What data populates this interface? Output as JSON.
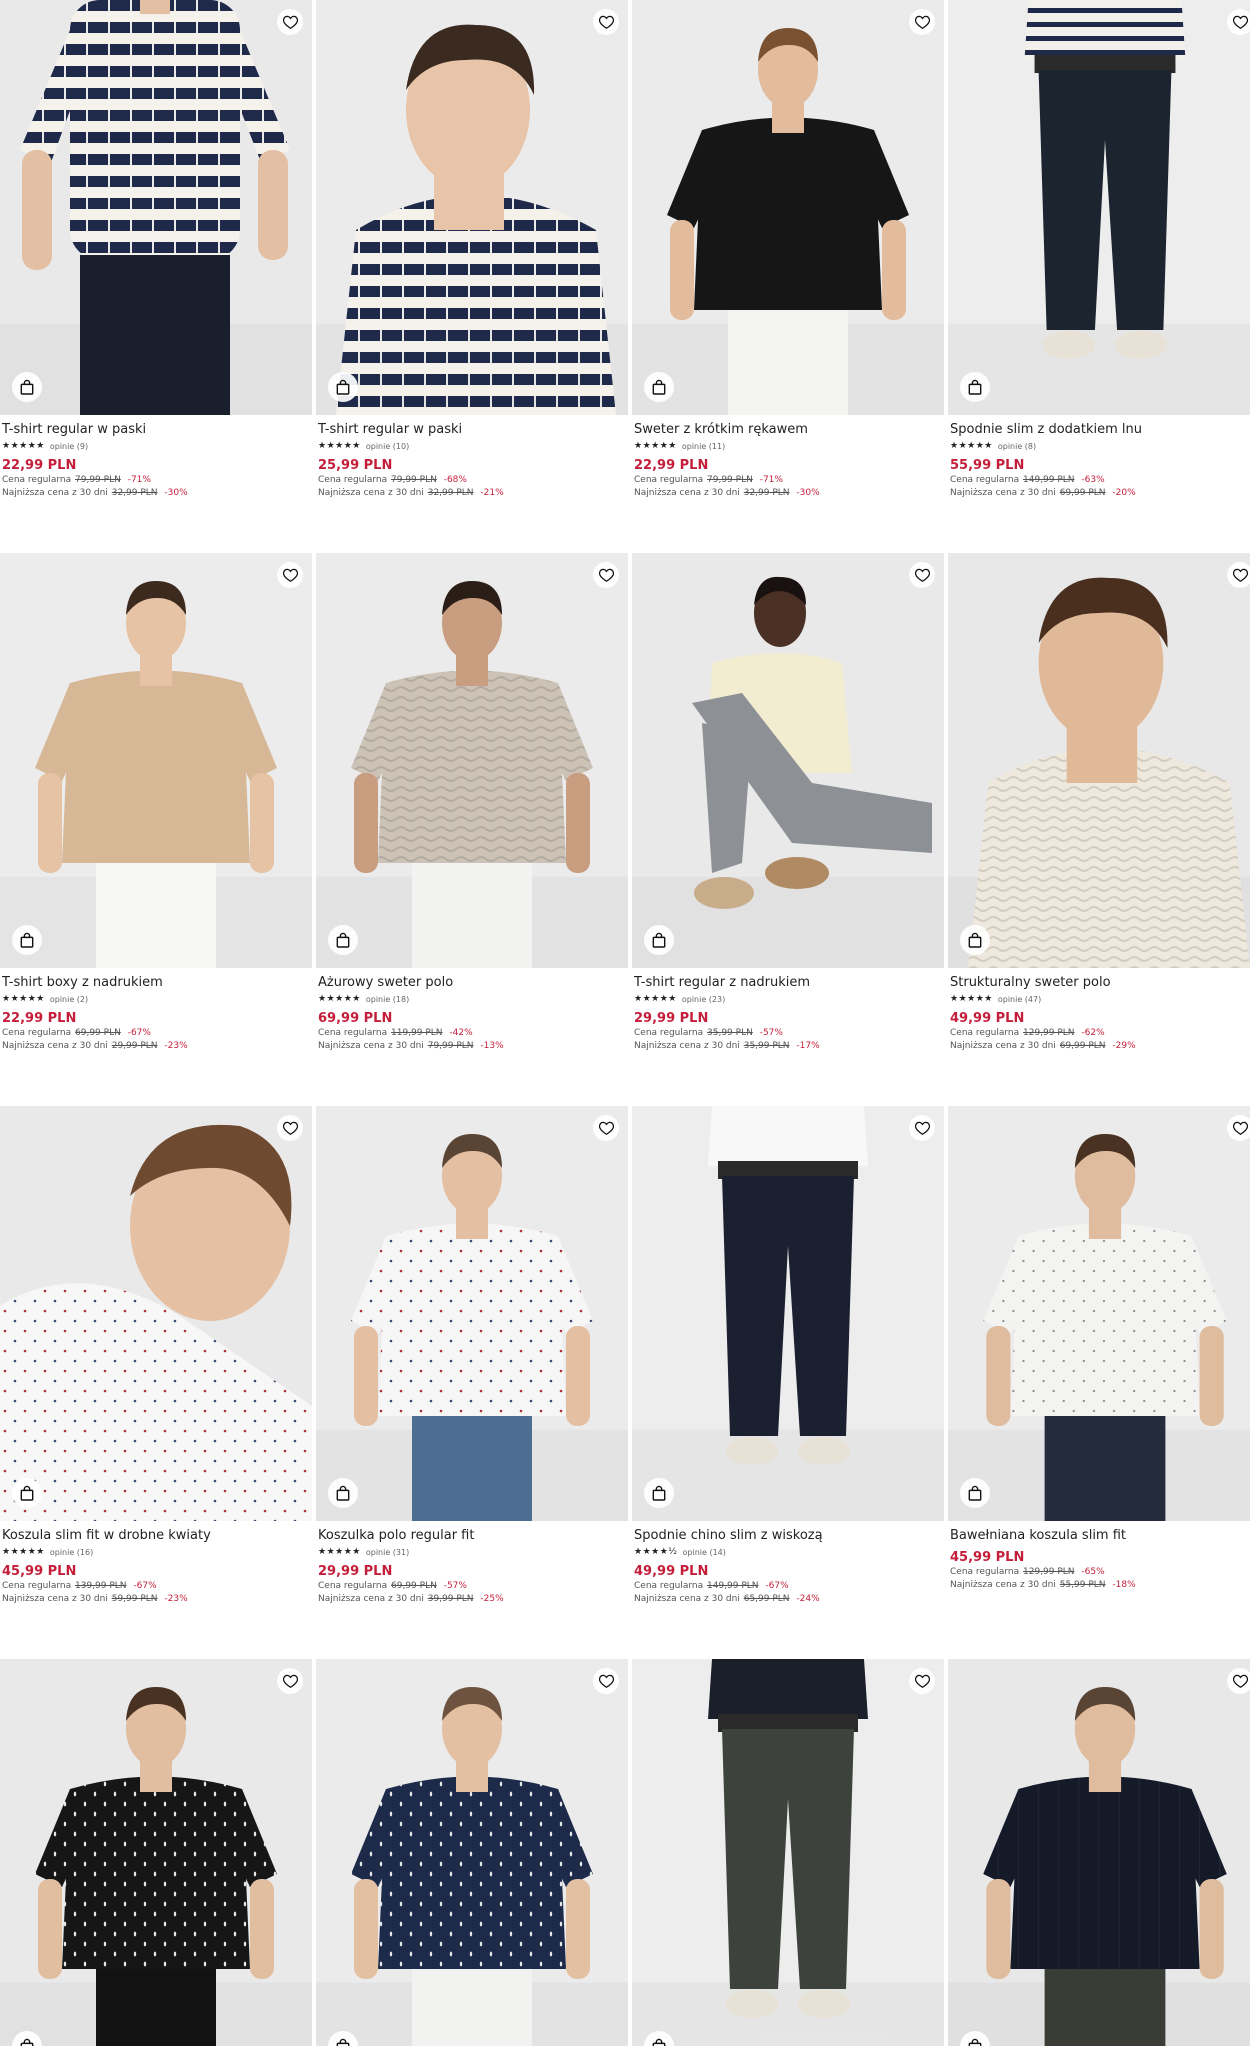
{
  "labels": {
    "regular": "Cena regularna",
    "lowest30": "Najniższa cena z 30 dni"
  },
  "products": [
    {
      "name": "T-shirt regular w paski",
      "stars": "★★★★★",
      "reviews": "opinie (9)",
      "price": "22,99 PLN",
      "regular_price": "79,99 PLN",
      "regular_discount": "-71%",
      "lowest_price": "32,99 PLN",
      "lowest_discount": "-30%",
      "bg": "#e9e9e9",
      "shirt": "#1f2a4a",
      "pattern": "stripes",
      "pants": "#1a1f2e",
      "skin": "#e3bfa3",
      "hair": "#5a3c28",
      "crop": "torso"
    },
    {
      "name": "T-shirt regular w paski",
      "stars": "★★★★★",
      "reviews": "opinie (10)",
      "price": "25,99 PLN",
      "regular_price": "79,99 PLN",
      "regular_discount": "-68%",
      "lowest_price": "32,99 PLN",
      "lowest_discount": "-21%",
      "bg": "#ebebeb",
      "shirt": "#1f2a4a",
      "pattern": "stripes",
      "pants": "#ebebeb",
      "skin": "#e8c4a8",
      "hair": "#3b2a20",
      "crop": "portrait"
    },
    {
      "name": "Sweter z krótkim rękawem",
      "stars": "★★★★★",
      "reviews": "opinie (11)",
      "price": "22,99 PLN",
      "regular_price": "79,99 PLN",
      "regular_discount": "-71%",
      "lowest_price": "32,99 PLN",
      "lowest_discount": "-30%",
      "bg": "#ebebeb",
      "shirt": "#161616",
      "pattern": "solid",
      "pants": "#f4f4f2",
      "skin": "#e2bc9c",
      "hair": "#7a5232",
      "crop": "half"
    },
    {
      "name": "Spodnie slim z dodatkiem lnu",
      "stars": "★★★★★",
      "reviews": "opinie (8)",
      "price": "55,99 PLN",
      "regular_price": "149,99 PLN",
      "regular_discount": "-63%",
      "lowest_price": "69,99 PLN",
      "lowest_discount": "-20%",
      "bg": "#ededed",
      "shirt": "#f2f0ea",
      "pattern": "stripes-light",
      "pants": "#1c2430",
      "skin": "#e4c2a6",
      "hair": "#5a3c28",
      "crop": "legs"
    },
    {
      "name": "T-shirt boxy z nadrukiem",
      "stars": "★★★★★",
      "reviews": "opinie (2)",
      "price": "22,99 PLN",
      "regular_price": "69,99 PLN",
      "regular_discount": "-67%",
      "lowest_price": "29,99 PLN",
      "lowest_discount": "-23%",
      "bg": "#ececec",
      "shirt": "#d6b796",
      "pattern": "solid",
      "pants": "#f6f6f4",
      "skin": "#e6c3a5",
      "hair": "#3d2a1e",
      "crop": "half"
    },
    {
      "name": "Ażurowy sweter polo",
      "stars": "★★★★★",
      "reviews": "opinie (18)",
      "price": "69,99 PLN",
      "regular_price": "119,99 PLN",
      "regular_discount": "-42%",
      "lowest_price": "79,99 PLN",
      "lowest_discount": "-13%",
      "bg": "#ebebeb",
      "shirt": "#ccc3b6",
      "pattern": "knit",
      "pants": "#f2f2f0",
      "skin": "#c99e80",
      "hair": "#2a1e16",
      "crop": "half"
    },
    {
      "name": "T-shirt regular z nadrukiem",
      "stars": "★★★★★",
      "reviews": "opinie (23)",
      "price": "29,99 PLN",
      "regular_price": "35,99 PLN",
      "regular_discount": "-57%",
      "lowest_price": "35,99 PLN",
      "lowest_discount": "-17%",
      "bg": "#e9e9e9",
      "shirt": "#f2ecd0",
      "pattern": "solid",
      "pants": "#8d9095",
      "skin": "#4a3025",
      "hair": "#1a1210",
      "crop": "sitting"
    },
    {
      "name": "Strukturalny sweter polo",
      "stars": "★★★★★",
      "reviews": "opinie (47)",
      "price": "49,99 PLN",
      "regular_price": "129,99 PLN",
      "regular_discount": "-62%",
      "lowest_price": "69,99 PLN",
      "lowest_discount": "-29%",
      "bg": "#e8e8e8",
      "shirt": "#efe8dc",
      "pattern": "knit",
      "pants": "#4a4d45",
      "skin": "#e0b998",
      "hair": "#4a2e1e",
      "crop": "portrait"
    },
    {
      "name": "Koszula slim fit w drobne kwiaty",
      "stars": "★★★★★",
      "reviews": "opinie (16)",
      "price": "45,99 PLN",
      "regular_price": "139,99 PLN",
      "regular_discount": "-67%",
      "lowest_price": "59,99 PLN",
      "lowest_discount": "-23%",
      "bg": "#e9e9e9",
      "shirt": "#f7f7f7",
      "pattern": "dots-red",
      "pants": "#e9e9e9",
      "skin": "#e6c0a2",
      "hair": "#6e4a30",
      "crop": "closeup"
    },
    {
      "name": "Koszulka polo regular fit",
      "stars": "★★★★★",
      "reviews": "opinie (31)",
      "price": "29,99 PLN",
      "regular_price": "69,99 PLN",
      "regular_discount": "-57%",
      "lowest_price": "39,99 PLN",
      "lowest_discount": "-25%",
      "bg": "#ebebeb",
      "shirt": "#f6f6f6",
      "pattern": "dots-red",
      "pants": "#4d6d92",
      "skin": "#e4bfa2",
      "hair": "#5a4434",
      "crop": "half"
    },
    {
      "name": "Spodnie chino slim z wiskozą",
      "stars": "★★★★½",
      "reviews": "opinie (14)",
      "price": "49,99 PLN",
      "regular_price": "149,99 PLN",
      "regular_discount": "-67%",
      "lowest_price": "65,99 PLN",
      "lowest_discount": "-24%",
      "bg": "#ededed",
      "shirt": "#f8f8f8",
      "pattern": "solid",
      "pants": "#1b2030",
      "skin": "#e4c2a6",
      "hair": "#5a3c28",
      "crop": "legs"
    },
    {
      "name": "Bawełniana koszula slim fit",
      "stars": "",
      "reviews": "",
      "price": "45,99 PLN",
      "regular_price": "129,99 PLN",
      "regular_discount": "-65%",
      "lowest_price": "55,99 PLN",
      "lowest_discount": "-18%",
      "bg": "#ebebeb",
      "shirt": "#f3f3f1",
      "pattern": "dots-grey",
      "pants": "#232b3c",
      "skin": "#e0bc9e",
      "hair": "#4a3222",
      "crop": "half"
    },
    {
      "name": "",
      "stars": "",
      "reviews": "",
      "price": "",
      "regular_price": "",
      "regular_discount": "",
      "lowest_price": "",
      "lowest_discount": "",
      "bg": "#e9e9e9",
      "shirt": "#161616",
      "pattern": "dots-white",
      "pants": "#121212",
      "skin": "#e2bea0",
      "hair": "#4a3222",
      "crop": "half"
    },
    {
      "name": "",
      "stars": "",
      "reviews": "",
      "price": "",
      "regular_price": "",
      "regular_discount": "",
      "lowest_price": "",
      "lowest_discount": "",
      "bg": "#ebebeb",
      "shirt": "#1d2a4a",
      "pattern": "dots-white",
      "pants": "#f2f2f0",
      "skin": "#e4c0a2",
      "hair": "#6e5440",
      "crop": "half"
    },
    {
      "name": "",
      "stars": "",
      "reviews": "",
      "price": "",
      "regular_price": "",
      "regular_discount": "",
      "lowest_price": "",
      "lowest_discount": "",
      "bg": "#ededed",
      "shirt": "#1b1f2a",
      "pattern": "solid",
      "pants": "#3e423c",
      "skin": "#e4c2a6",
      "hair": "#5a3c28",
      "crop": "legs"
    },
    {
      "name": "",
      "stars": "",
      "reviews": "",
      "price": "",
      "regular_price": "",
      "regular_discount": "",
      "lowest_price": "",
      "lowest_discount": "",
      "bg": "#e8e8e8",
      "shirt": "#141a28",
      "pattern": "knit-dark",
      "pants": "#3a3d36",
      "skin": "#e0bc9e",
      "hair": "#5a4434",
      "crop": "half"
    }
  ]
}
